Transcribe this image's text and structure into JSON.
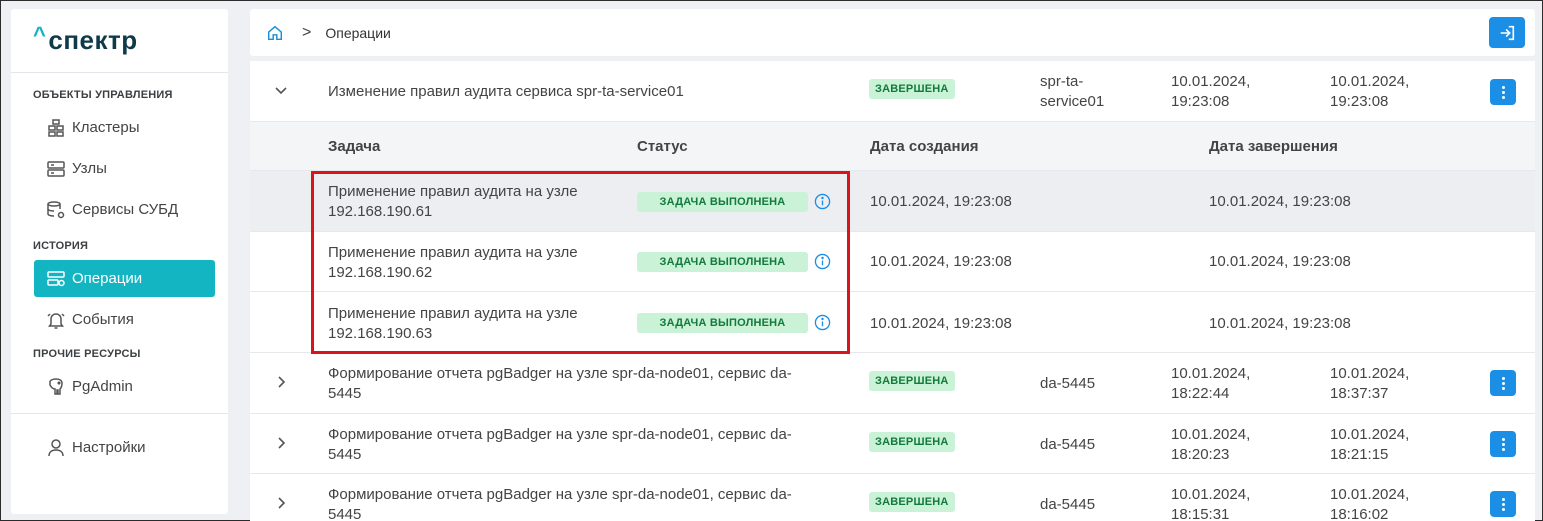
{
  "app": {
    "logo_caret": "^",
    "logo_text": "спектр"
  },
  "sidebar": {
    "section_objects": "ОБЪЕКТЫ УПРАВЛЕНИЯ",
    "clusters": "Кластеры",
    "nodes": "Узлы",
    "dbms_services": "Сервисы СУБД",
    "section_history": "ИСТОРИЯ",
    "operations": "Операции",
    "events": "События",
    "section_other": "ПРОЧИЕ РЕСУРСЫ",
    "pgadmin": "PgAdmin",
    "settings": "Настройки"
  },
  "breadcrumb": {
    "separator": ">",
    "current": "Операции"
  },
  "operations": [
    {
      "name": "Изменение правил аудита сервиса spr-ta-service01",
      "status": "ЗАВЕРШЕНА",
      "service_line1": "spr-ta-",
      "service_line2": "service01",
      "created_date": "10.01.2024,",
      "created_time": "19:23:08",
      "finished_date": "10.01.2024,",
      "finished_time": "19:23:08"
    },
    {
      "name_line1": "Формирование отчета pgBadger на узле spr-da-node01, сервис da-",
      "name_line2": "5445",
      "status": "ЗАВЕРШЕНА",
      "service": "da-5445",
      "created_date": "10.01.2024,",
      "created_time": "18:22:44",
      "finished_date": "10.01.2024,",
      "finished_time": "18:37:37"
    },
    {
      "name_line1": "Формирование отчета pgBadger на узле spr-da-node01, сервис da-",
      "name_line2": "5445",
      "status": "ЗАВЕРШЕНА",
      "service": "da-5445",
      "created_date": "10.01.2024,",
      "created_time": "18:20:23",
      "finished_date": "10.01.2024,",
      "finished_time": "18:21:15"
    },
    {
      "name_line1": "Формирование отчета pgBadger на узле spr-da-node01, сервис da-",
      "name_line2": "5445",
      "status": "ЗАВЕРШЕНА",
      "service": "da-5445",
      "created_date": "10.01.2024,",
      "created_time": "18:15:31",
      "finished_date": "10.01.2024,",
      "finished_time": "18:16:02"
    }
  ],
  "subtable": {
    "headers": {
      "task": "Задача",
      "status": "Статус",
      "created": "Дата создания",
      "finished": "Дата завершения"
    },
    "rows": [
      {
        "task_line1": "Применение правил аудита на узле",
        "task_line2": "192.168.190.61",
        "status": "ЗАДАЧА ВЫПОЛНЕНА",
        "created": "10.01.2024, 19:23:08",
        "finished": "10.01.2024, 19:23:08"
      },
      {
        "task_line1": "Применение правил аудита на узле",
        "task_line2": "192.168.190.62",
        "status": "ЗАДАЧА ВЫПОЛНЕНА",
        "created": "10.01.2024, 19:23:08",
        "finished": "10.01.2024, 19:23:08"
      },
      {
        "task_line1": "Применение правил аудита на узле",
        "task_line2": "192.168.190.63",
        "status": "ЗАДАЧА ВЫПОЛНЕНА",
        "created": "10.01.2024, 19:23:08",
        "finished": "10.01.2024, 19:23:08"
      }
    ]
  },
  "colors": {
    "accent": "#13b5c2",
    "primary_button": "#1b8fe6",
    "status_bg": "#c9f2d6",
    "status_text": "#127a3c",
    "highlight_border": "#d9141b"
  }
}
